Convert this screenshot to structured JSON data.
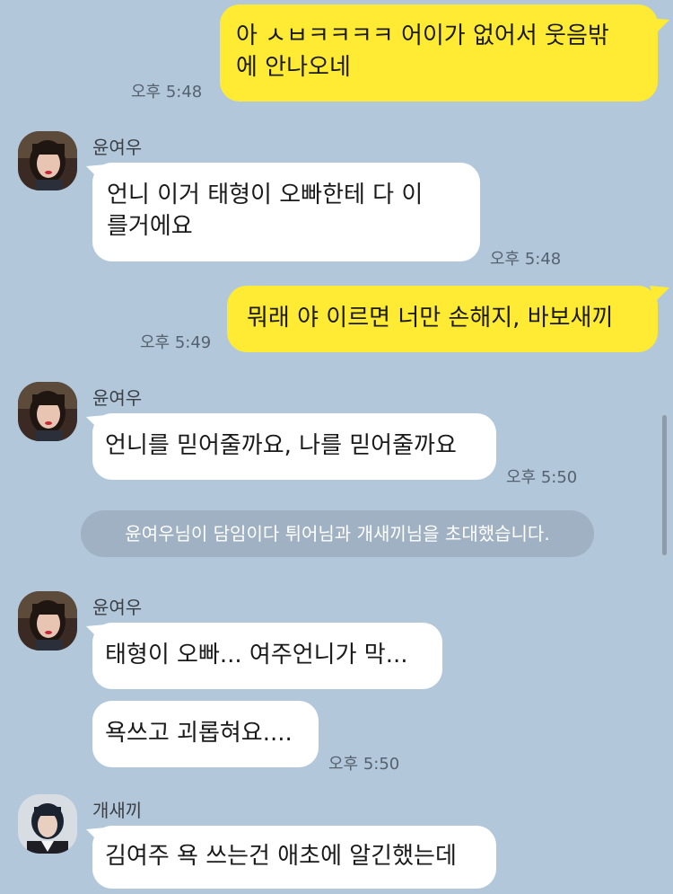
{
  "messages": {
    "m1": {
      "line1": "아 ㅅㅂㅋㅋㅋㅋ 어이가 없어서 웃음밖",
      "line2": "에 안나오네",
      "time": "오후 5:48"
    },
    "m2": {
      "sender": "윤여우",
      "line1": "언니 이거 태형이 오빠한테 다 이",
      "line2": "를거에요",
      "time": "오후 5:48"
    },
    "m3": {
      "text": "뭐래 야 이르면 너만 손해지, 바보새끼",
      "time": "오후 5:49"
    },
    "m4": {
      "sender": "윤여우",
      "text": "언니를 믿어줄까요, 나를 믿어줄까요",
      "time": "오후 5:50"
    },
    "system": {
      "text": "윤여우님이 담임이다 튀어님과 개새끼님을 초대했습니다."
    },
    "m5": {
      "sender": "윤여우",
      "text1": "태형이 오빠... 여주언니가 막...",
      "text2": "욕쓰고 괴롭혀요....",
      "time": "오후 5:50"
    },
    "m6": {
      "sender": "개새끼",
      "text": "김여주 욕 쓰는건 애초에 알긴했는데"
    }
  },
  "colors": {
    "background": "#b2c7da",
    "my_bubble": "#ffeb33",
    "other_bubble": "#ffffff",
    "system_bg": "#9fb1c2"
  },
  "icons": {
    "avatar_1": "profile-photo-red-hair",
    "avatar_2": "profile-photo-dark-hair"
  }
}
